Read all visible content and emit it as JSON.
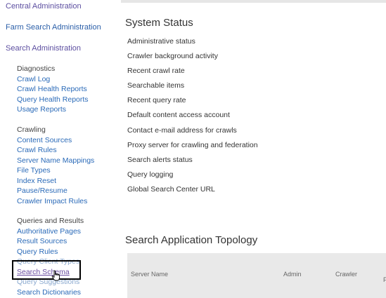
{
  "nav": {
    "central_admin": "Central Administration",
    "farm_search_admin": "Farm Search Administration",
    "search_admin": "Search Administration",
    "diagnostics": {
      "heading": "Diagnostics",
      "links": [
        "Crawl Log",
        "Crawl Health Reports",
        "Query Health Reports",
        "Usage Reports"
      ]
    },
    "crawling": {
      "heading": "Crawling",
      "links": [
        "Content Sources",
        "Crawl Rules",
        "Server Name Mappings",
        "File Types",
        "Index Reset",
        "Pause/Resume",
        "Crawler Impact Rules"
      ]
    },
    "queries": {
      "heading": "Queries and Results",
      "links": [
        "Authoritative Pages",
        "Result Sources",
        "Query Rules",
        "Query Client Types",
        "Search Schema",
        "Query Suggestions",
        "Search Dictionaries"
      ]
    }
  },
  "main": {
    "system_status": {
      "title": "System Status",
      "items": [
        "Administrative status",
        "Crawler background activity",
        "Recent crawl rate",
        "Searchable items",
        "Recent query rate",
        "Default content access account",
        "Contact e-mail address for crawls",
        "Proxy server for crawling and federation",
        "Search alerts status",
        "Query logging",
        "Global Search Center URL"
      ]
    },
    "topology": {
      "title": "Search Application Topology",
      "columns": [
        "Server Name",
        "Admin",
        "Crawler",
        "F"
      ]
    }
  },
  "colors": {
    "link": "#2a6ab8",
    "visited_link": "#5c4ea0",
    "highlight_border": "#000000",
    "table_header_bg": "#e9e9e9"
  },
  "icons": {
    "cursor": "hand-pointer-icon"
  }
}
